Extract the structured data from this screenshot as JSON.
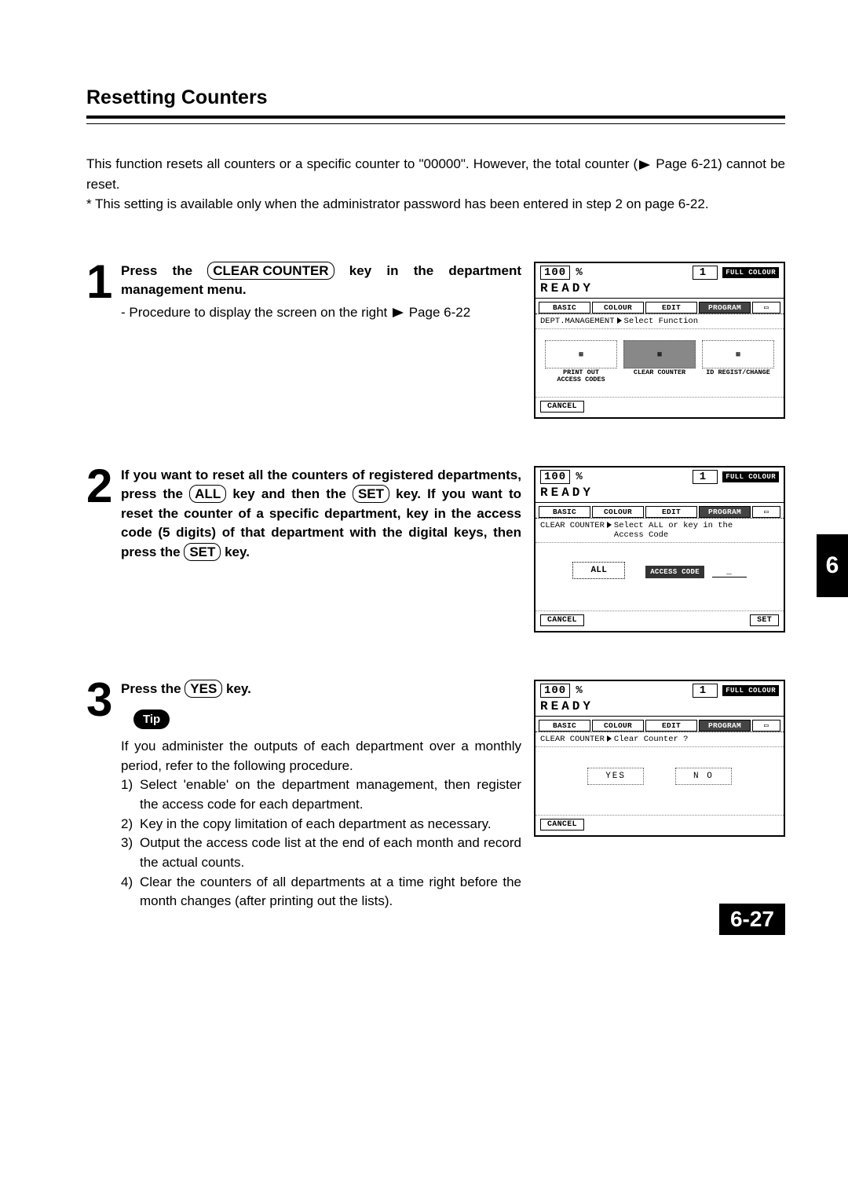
{
  "title": "Resetting Counters",
  "intro_line1": "This function resets all counters or a specific counter to \"00000\".  However, the total counter (",
  "intro_page_ref1": " Page 6-21) cannot be reset.",
  "intro_note": "* This setting is available only when the administrator password has been entered in step 2 on page 6-22.",
  "step1": {
    "num": "1",
    "pre": "Press the ",
    "key": "CLEAR COUNTER",
    "post": " key in the department management menu.",
    "sub_pre": "-  Procedure to display the screen on the right ",
    "sub_post": " Page 6-22"
  },
  "step2": {
    "num": "2",
    "t1": "If you want to reset all the counters of registered departments, press the ",
    "k1": "ALL",
    "t2": " key and then the ",
    "k2": "SET",
    "t3": " key.  If you want to reset the counter of a specific department, key in the access code (5 digits) of that department with the digital keys, then press the ",
    "k3": "SET",
    "t4": " key."
  },
  "step3": {
    "num": "3",
    "pre": "Press the ",
    "key": "YES",
    "post": " key."
  },
  "tip_label": "Tip",
  "tip_intro": "If you administer the outputs of each department over a monthly period, refer to the following procedure.",
  "tip_items": [
    "Select 'enable' on the department management, then register the access code for each department.",
    "Key in the copy limitation of each department as necessary.",
    "Output the access code list at the end of each month and record the actual counts.",
    "Clear the counters of all departments at a time right before the month changes (after printing out the lists)."
  ],
  "screen_common": {
    "pct100": "100",
    "pct": "%",
    "one": "1",
    "full_colour": "FULL COLOUR",
    "ready": "READY",
    "tabs": [
      "BASIC",
      "COLOUR",
      "EDIT",
      "PROGRAM"
    ],
    "cancel": "CANCEL"
  },
  "screen1": {
    "status_a": "DEPT.MANAGEMENT",
    "status_b": "Select Function",
    "funcs": [
      {
        "label": "PRINT OUT\nACCESS CODES"
      },
      {
        "label": "CLEAR COUNTER"
      },
      {
        "label": "ID REGIST/CHANGE"
      }
    ]
  },
  "screen2": {
    "status_a": "CLEAR COUNTER",
    "status_b": "Select ALL or key in the\nAccess Code",
    "all": "ALL",
    "access_code": "ACCESS CODE",
    "underscore": "_",
    "set": "SET"
  },
  "screen3": {
    "status_a": "CLEAR COUNTER",
    "status_b": "Clear Counter ?",
    "yes": "YES",
    "no": "N O"
  },
  "side_tab": "6",
  "page_number": "6-27"
}
